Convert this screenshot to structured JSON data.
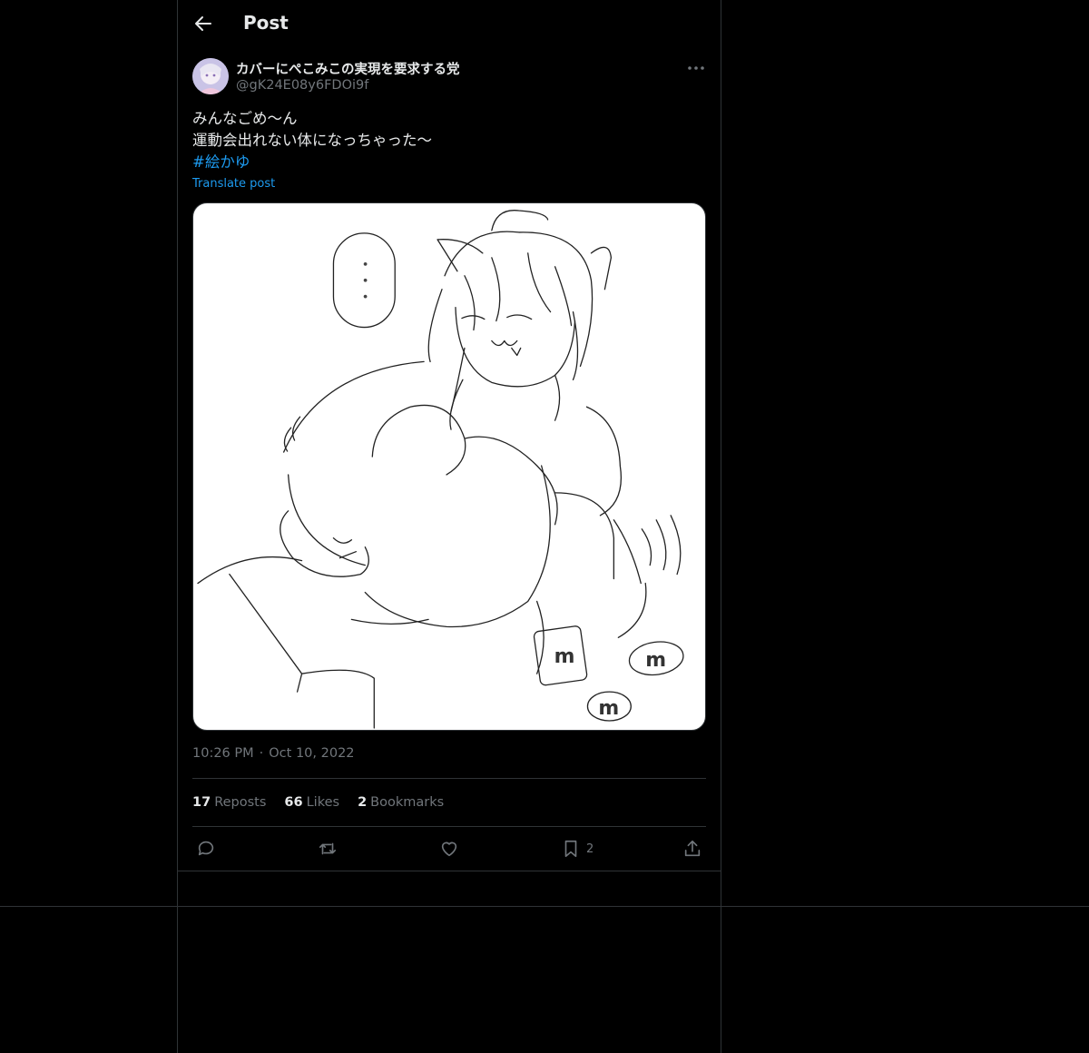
{
  "header": {
    "title": "Post"
  },
  "author": {
    "display_name": "カバーにぺこみこの実現を要求する党",
    "handle": "@gK24E08y6FDOi9f"
  },
  "post": {
    "lines": [
      "みんなごめ〜ん",
      "運動会出れない体になっちゃった〜"
    ],
    "hashtag": "#絵かゆ",
    "translate_label": "Translate post",
    "speech_bubble_text": "・・・",
    "time": "10:26 PM",
    "date": "Oct 10, 2022"
  },
  "stats": {
    "reposts_count": "17",
    "reposts_label": "Reposts",
    "likes_count": "66",
    "likes_label": "Likes",
    "bookmarks_count": "2",
    "bookmarks_label": "Bookmarks"
  },
  "actions": {
    "bookmark_count": "2"
  },
  "colors": {
    "accent": "#1d9bf0",
    "background": "#000000",
    "border": "#2f3336",
    "secondary_text": "#71767b"
  }
}
